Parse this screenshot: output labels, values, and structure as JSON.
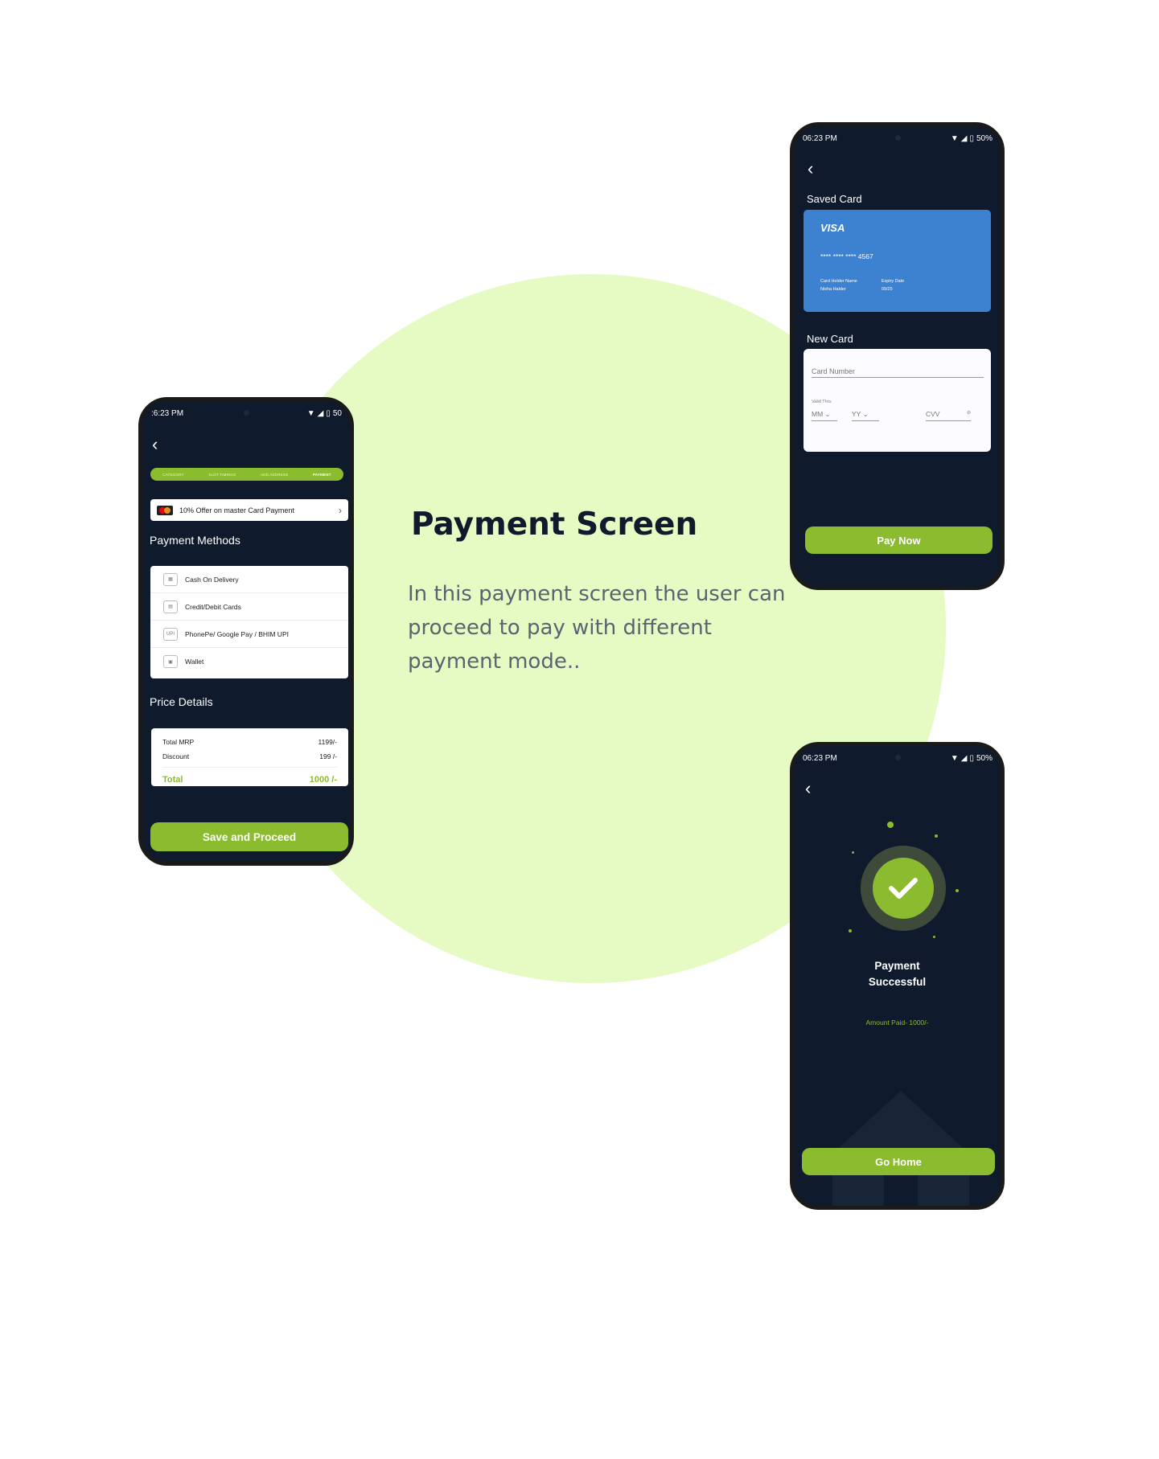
{
  "headline": "Payment Screen",
  "description": "In this payment screen the user can proceed to pay with different payment mode..",
  "colors": {
    "accent": "#8bbb2e",
    "phone_bg": "#0f1b2d",
    "card_blue": "#3c82d1",
    "blob": "#e6fac3"
  },
  "phone1": {
    "status_time": ":6:23 PM",
    "status_battery": "50",
    "steps": [
      "CATEGORY",
      "SLOT TIMINGS",
      "ADD ADDRESS",
      "PAYMENT"
    ],
    "active_step": "PAYMENT",
    "offer_text": "10% Offer on master Card Payment",
    "methods_title": "Payment Methods",
    "methods": [
      {
        "label": "Cash On Delivery",
        "icon": "cash-icon"
      },
      {
        "label": "Credit/Debit Cards",
        "icon": "card-icon"
      },
      {
        "label": "PhonePe/ Google Pay / BHIM UPI",
        "icon": "upi-icon",
        "icon_text": "UPI"
      },
      {
        "label": "Wallet",
        "icon": "wallet-icon"
      }
    ],
    "price_title": "Price Details",
    "price_rows": [
      {
        "label": "Total MRP",
        "value": "1199/-"
      },
      {
        "label": "Discount",
        "value": "199 /-"
      }
    ],
    "total_label": "Total",
    "total_value": "1000 /-",
    "button": "Save and Proceed"
  },
  "phone2": {
    "status_time": "06:23 PM",
    "status_battery": "50%",
    "saved_title": "Saved Card",
    "card_brand": "VISA",
    "card_number": "**** **** **** 4567",
    "holder_label": "Card Holder Name",
    "holder_name": "Nisha Halder",
    "expiry_label": "Expiry Date",
    "expiry_value": "09/25",
    "new_title": "New Card",
    "card_number_placeholder": "Card Number",
    "valid_thru": "Valid Thru",
    "mm": "MM",
    "yy": "YY",
    "cvv": "CVV",
    "button": "Pay Now"
  },
  "phone3": {
    "status_time": "06:23 PM",
    "status_battery": "50%",
    "success_line1": "Payment",
    "success_line2": "Successful",
    "amount": "Amount Paid- 1000/-",
    "button": "Go Home"
  }
}
